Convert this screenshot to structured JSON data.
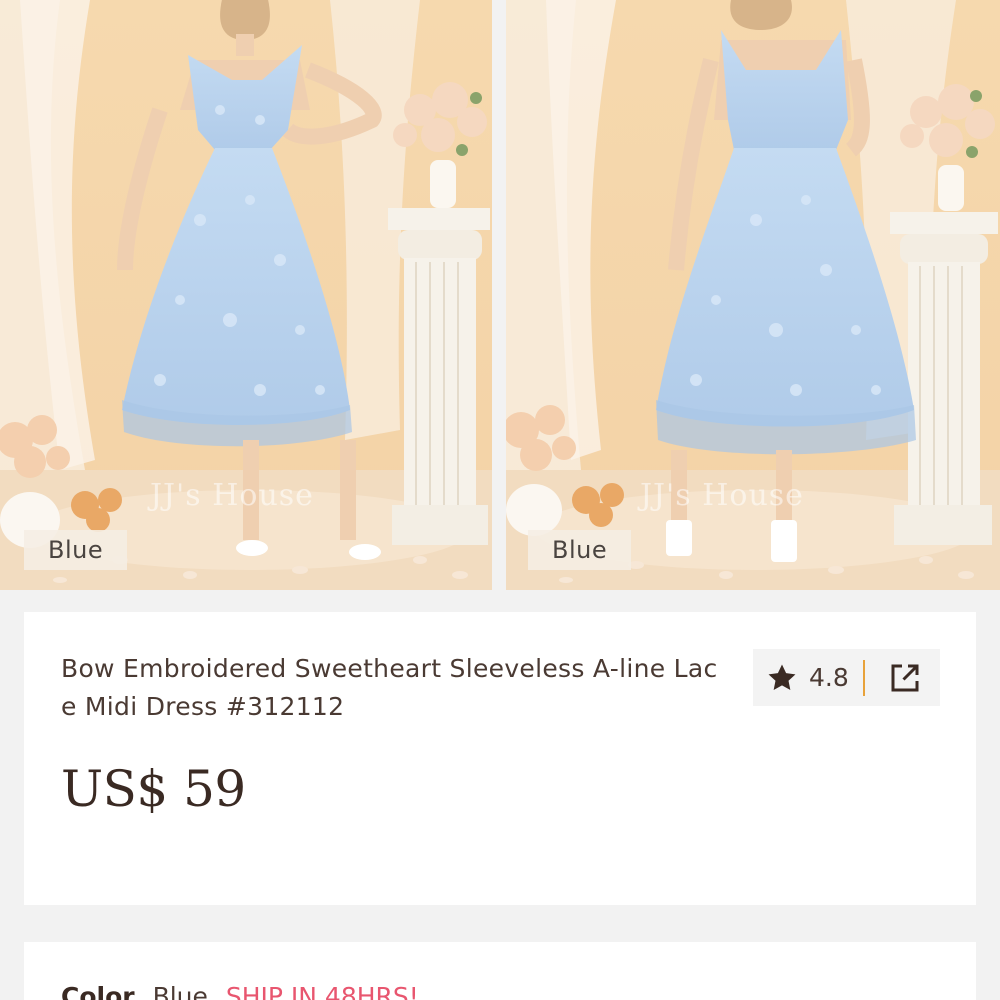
{
  "gallery": {
    "images": [
      {
        "view": "front",
        "color_tag": "Blue",
        "watermark": "JJ's House"
      },
      {
        "view": "back",
        "color_tag": "Blue",
        "watermark": "JJ's House"
      }
    ]
  },
  "product": {
    "title": "Bow Embroidered Sweetheart Sleeveless A-line Lace Midi Dress #312112",
    "rating": "4.8",
    "price": "US$ 59",
    "icons": {
      "rating": "star-icon",
      "share": "share-icon"
    }
  },
  "color_section": {
    "label": "Color",
    "selected": "Blue",
    "shipping_badge": "SHIP IN 48HRS!"
  },
  "colors": {
    "accent": "#e8566f",
    "divider": "#e8a23a",
    "dress": "#b9d3ee",
    "background": "#f2f2f2"
  }
}
